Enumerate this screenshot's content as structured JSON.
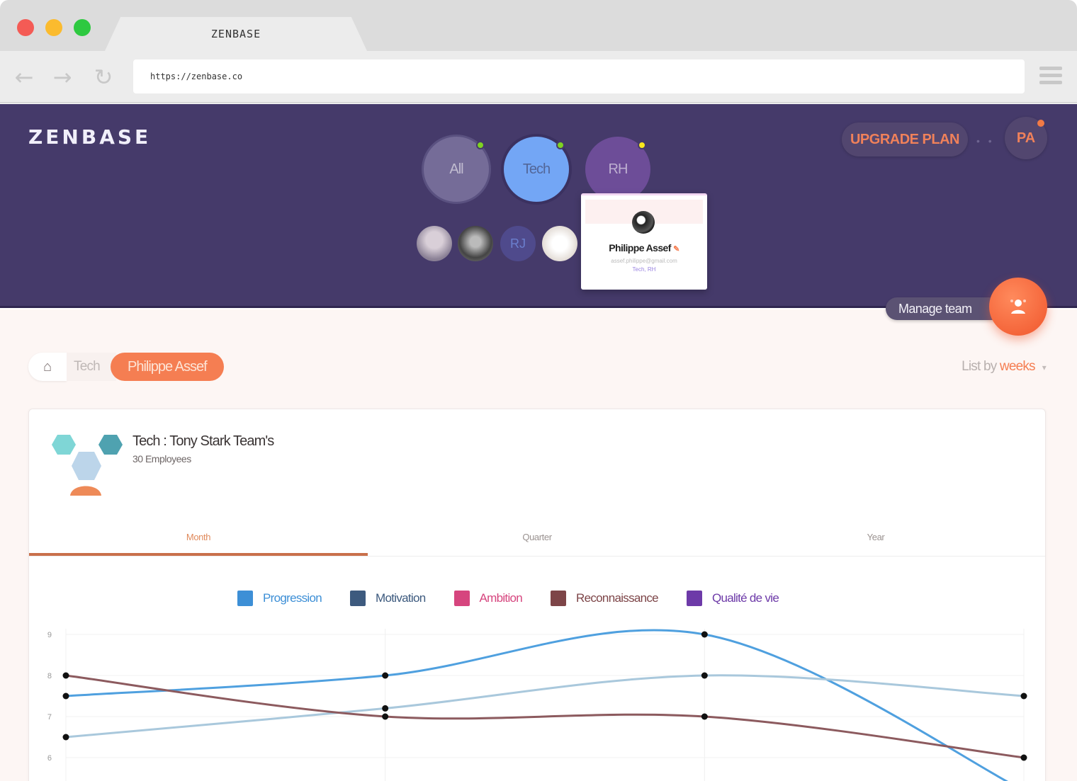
{
  "browser": {
    "tab_title": "ZENBASE",
    "url": "https://zenbase.co",
    "back_icon": "←",
    "forward_icon": "→",
    "reload_icon": "↻"
  },
  "header": {
    "logo": "ZENBASE",
    "teams": [
      {
        "label": "All",
        "status_color": "#7ed321"
      },
      {
        "label": "Tech",
        "status_color": "#7ed321"
      },
      {
        "label": "RH",
        "status_color": "#f8e71c"
      }
    ],
    "members": [
      {
        "label": ""
      },
      {
        "label": ""
      },
      {
        "label": "RJ"
      },
      {
        "label": ""
      }
    ],
    "popover": {
      "name": "Philippe Assef",
      "email": "assef.philippe@gmail.com",
      "teams": "Tech, RH"
    },
    "upgrade_label": "UPGRADE PLAN",
    "separator": "• •",
    "user_initials": "PA"
  },
  "manage_team": {
    "label": "Manage team",
    "icon": "manage-team-icon"
  },
  "breadcrumb": {
    "home_icon": "home-icon",
    "home_glyph": "⌂",
    "team": "Tech",
    "current": "Philippe Assef"
  },
  "list_by": {
    "prefix": "List by ",
    "value": "weeks",
    "arrow": "▾"
  },
  "team_card": {
    "title": "Tech : Tony Stark Team's",
    "subtitle": "30 Employees",
    "tabs": [
      {
        "label": "Month",
        "active": true
      },
      {
        "label": "Quarter",
        "active": false
      },
      {
        "label": "Year",
        "active": false
      }
    ]
  },
  "chart_data": {
    "type": "line",
    "title": "",
    "xlabel": "",
    "ylabel": "",
    "x": [
      1,
      2,
      3,
      4
    ],
    "ylim": [
      6,
      9
    ],
    "yticks": [
      9,
      8,
      7,
      6
    ],
    "grid": true,
    "legend_position": "top",
    "legend": [
      {
        "name": "Progression",
        "color": "#3d8fd6"
      },
      {
        "name": "Motivation",
        "color": "#3d5a7e"
      },
      {
        "name": "Ambition",
        "color": "#d6457e"
      },
      {
        "name": "Reconnaissance",
        "color": "#7d4548"
      },
      {
        "name": "Qualité de vie",
        "color": "#6d3aa8"
      }
    ],
    "series": [
      {
        "color": "#4fa0df",
        "values": [
          7.5,
          8,
          9,
          5.2
        ]
      },
      {
        "color": "#a9c8dc",
        "values": [
          6.5,
          7.2,
          8,
          7.5
        ]
      },
      {
        "color": "#8c5a5e",
        "values": [
          8,
          7,
          7,
          6
        ]
      }
    ]
  }
}
